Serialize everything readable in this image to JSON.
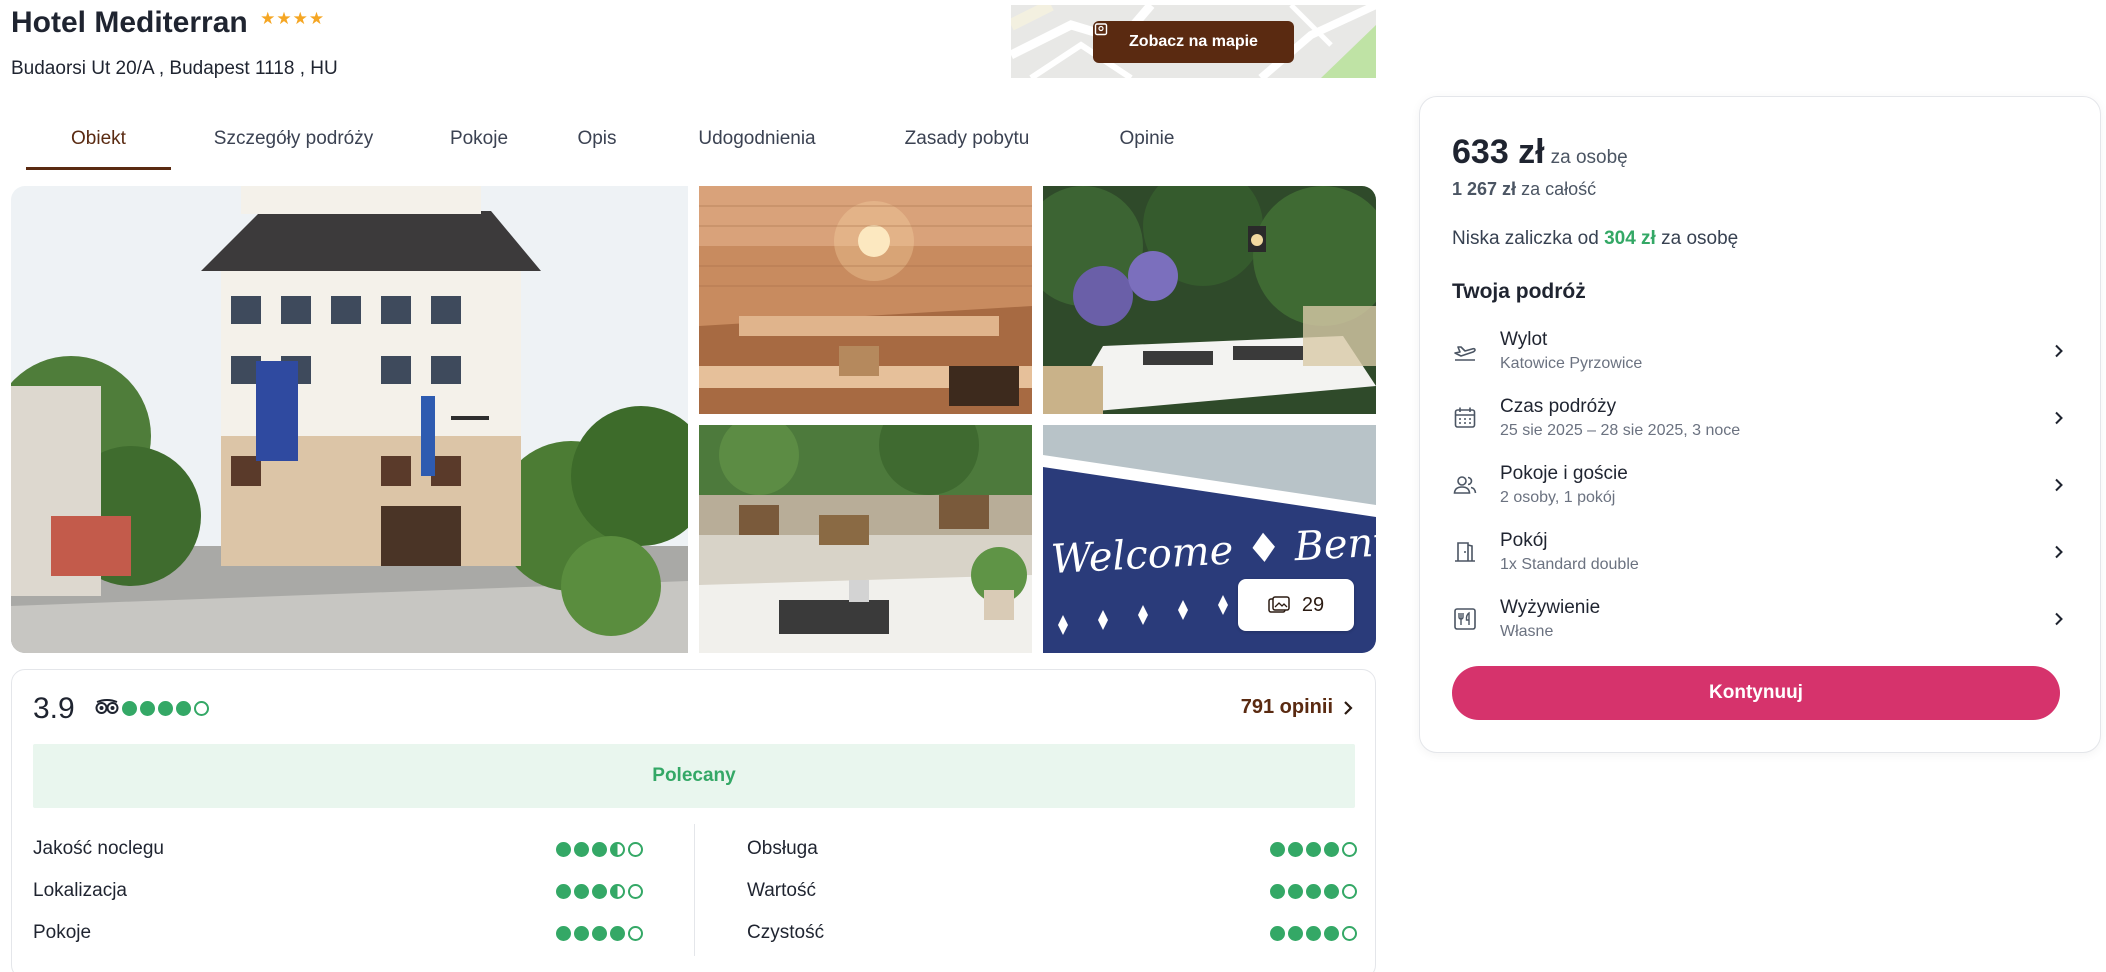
{
  "hotel": {
    "name": "Hotel Mediterran",
    "stars": "★★★★",
    "address": "Budaorsi Ut 20/A , Budapest 1118 , HU"
  },
  "map": {
    "button_label": "Zobacz na mapie",
    "icon": "map-pin-icon"
  },
  "tabs": [
    {
      "label": "Obiekt",
      "active": true
    },
    {
      "label": "Szczegóły podróży",
      "active": false
    },
    {
      "label": "Pokoje",
      "active": false
    },
    {
      "label": "Opis",
      "active": false
    },
    {
      "label": "Udogodnienia",
      "active": false
    },
    {
      "label": "Zasady pobytu",
      "active": false
    },
    {
      "label": "Opinie",
      "active": false
    }
  ],
  "gallery": {
    "photo_count": "29",
    "welcome_text": "Welcome ♦ Benvenuto"
  },
  "rating": {
    "score": "3.9",
    "bubbles": 4,
    "reviews_label": "791 opinii",
    "recommended_label": "Polecany",
    "criteria_left": [
      {
        "label": "Jakość noclegu",
        "value": 3.5
      },
      {
        "label": "Lokalizacja",
        "value": 3.5
      },
      {
        "label": "Pokoje",
        "value": 4
      }
    ],
    "criteria_right": [
      {
        "label": "Obsługa",
        "value": 4
      },
      {
        "label": "Wartość",
        "value": 4
      },
      {
        "label": "Czystość",
        "value": 4
      }
    ]
  },
  "booking": {
    "price": "633 zł",
    "price_per": "za osobę",
    "total_price": "1 267 zł",
    "total_label": "za całość",
    "deposit_prefix": "Niska zaliczka od",
    "deposit_amount": "304 zł",
    "deposit_suffix": "za osobę",
    "trip_title": "Twoja podróż",
    "trip_items": [
      {
        "label": "Wylot",
        "value": "Katowice Pyrzowice",
        "icon": "plane-departure-icon"
      },
      {
        "label": "Czas podróży",
        "value": "25 sie 2025 – 28 sie 2025, 3 noce",
        "icon": "calendar-icon"
      },
      {
        "label": "Pokoje i goście",
        "value": "2 osoby, 1 pokój",
        "icon": "guests-icon"
      },
      {
        "label": "Pokój",
        "value": "1x Standard double",
        "icon": "door-icon"
      },
      {
        "label": "Wyżywienie",
        "value": "Własne",
        "icon": "cutlery-icon"
      }
    ],
    "continue_label": "Kontynuuj"
  },
  "colors": {
    "brand_brown": "#5a2a11",
    "accent_pink": "#d6336c",
    "rating_green": "#34a866",
    "star_gold": "#f5a623"
  }
}
